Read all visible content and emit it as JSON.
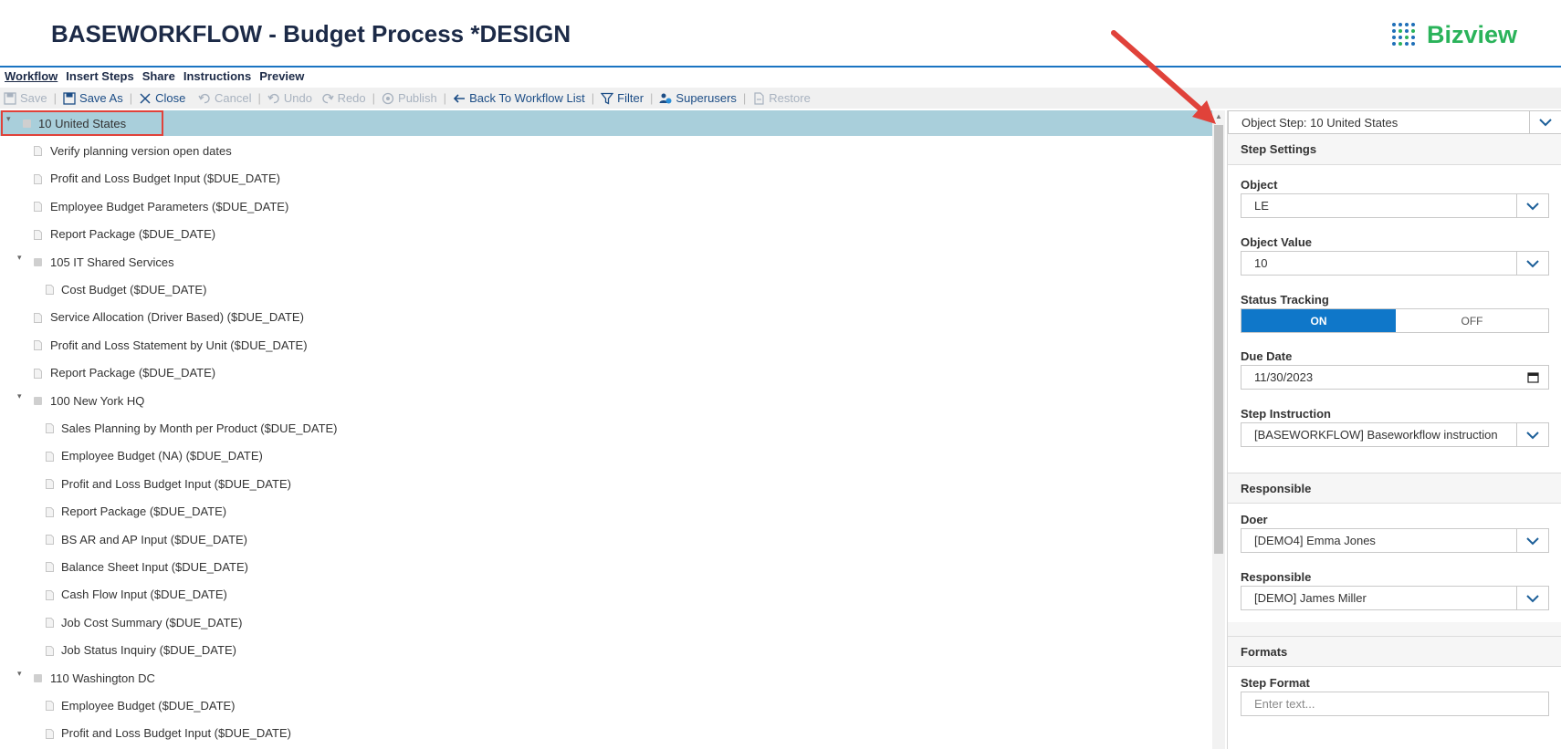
{
  "header": {
    "title": "BASEWORKFLOW - Budget Process *DESIGN",
    "brand": "Bizview"
  },
  "menu": [
    "Workflow",
    "Insert Steps",
    "Share",
    "Instructions",
    "Preview"
  ],
  "toolbar": {
    "save": "Save",
    "save_as": "Save As",
    "close": "Close",
    "cancel": "Cancel",
    "undo": "Undo",
    "redo": "Redo",
    "publish": "Publish",
    "back": "Back To Workflow List",
    "filter": "Filter",
    "superusers": "Superusers",
    "restore": "Restore"
  },
  "tree": [
    {
      "label": "10 United States",
      "level": 0,
      "type": "group",
      "selected": true
    },
    {
      "label": "Verify planning version open dates",
      "level": 1,
      "type": "step"
    },
    {
      "label": "Profit and Loss Budget Input ($DUE_DATE)",
      "level": 1,
      "type": "step"
    },
    {
      "label": "Employee Budget Parameters ($DUE_DATE)",
      "level": 1,
      "type": "step"
    },
    {
      "label": "Report Package ($DUE_DATE)",
      "level": 1,
      "type": "step"
    },
    {
      "label": "105 IT Shared Services",
      "level": 1,
      "type": "group"
    },
    {
      "label": "Cost Budget ($DUE_DATE)",
      "level": 2,
      "type": "step"
    },
    {
      "label": "Service Allocation (Driver Based) ($DUE_DATE)",
      "level": 1,
      "type": "step"
    },
    {
      "label": "Profit and Loss Statement by Unit ($DUE_DATE)",
      "level": 1,
      "type": "step"
    },
    {
      "label": "Report Package ($DUE_DATE)",
      "level": 1,
      "type": "step"
    },
    {
      "label": "100 New York HQ",
      "level": 1,
      "type": "group"
    },
    {
      "label": "Sales Planning by Month per Product ($DUE_DATE)",
      "level": 2,
      "type": "step"
    },
    {
      "label": "Employee Budget (NA) ($DUE_DATE)",
      "level": 2,
      "type": "step"
    },
    {
      "label": "Profit and Loss Budget Input ($DUE_DATE)",
      "level": 2,
      "type": "step"
    },
    {
      "label": "Report Package ($DUE_DATE)",
      "level": 2,
      "type": "step"
    },
    {
      "label": "BS AR and AP Input ($DUE_DATE)",
      "level": 2,
      "type": "step"
    },
    {
      "label": "Balance Sheet Input ($DUE_DATE)",
      "level": 2,
      "type": "step"
    },
    {
      "label": "Cash Flow Input ($DUE_DATE)",
      "level": 2,
      "type": "step"
    },
    {
      "label": "Job Cost Summary ($DUE_DATE)",
      "level": 2,
      "type": "step"
    },
    {
      "label": "Job Status Inquiry ($DUE_DATE)",
      "level": 2,
      "type": "step"
    },
    {
      "label": "110 Washington DC",
      "level": 1,
      "type": "group"
    },
    {
      "label": "Employee Budget ($DUE_DATE)",
      "level": 2,
      "type": "step"
    },
    {
      "label": "Profit and Loss Budget Input ($DUE_DATE)",
      "level": 2,
      "type": "step"
    }
  ],
  "panel": {
    "header": "Object Step: 10 United States",
    "step_settings": "Step Settings",
    "object_label": "Object",
    "object_value": "LE",
    "object_value_label": "Object Value",
    "object_value_value": "10",
    "status_tracking_label": "Status Tracking",
    "status_on": "ON",
    "status_off": "OFF",
    "due_date_label": "Due Date",
    "due_date_value": "11/30/2023",
    "step_instruction_label": "Step Instruction",
    "step_instruction_value": "[BASEWORKFLOW] Baseworkflow instruction",
    "responsible_section": "Responsible",
    "doer_label": "Doer",
    "doer_value": "[DEMO4] Emma Jones",
    "responsible_label": "Responsible",
    "responsible_value": "[DEMO] James Miller",
    "formats_section": "Formats",
    "step_format_label": "Step Format",
    "step_format_placeholder": "Enter text..."
  },
  "colors": {
    "accent": "#0f77c9",
    "brand": "#2ab35a",
    "selection": "#a9cfdb",
    "highlight": "#e0423a"
  }
}
